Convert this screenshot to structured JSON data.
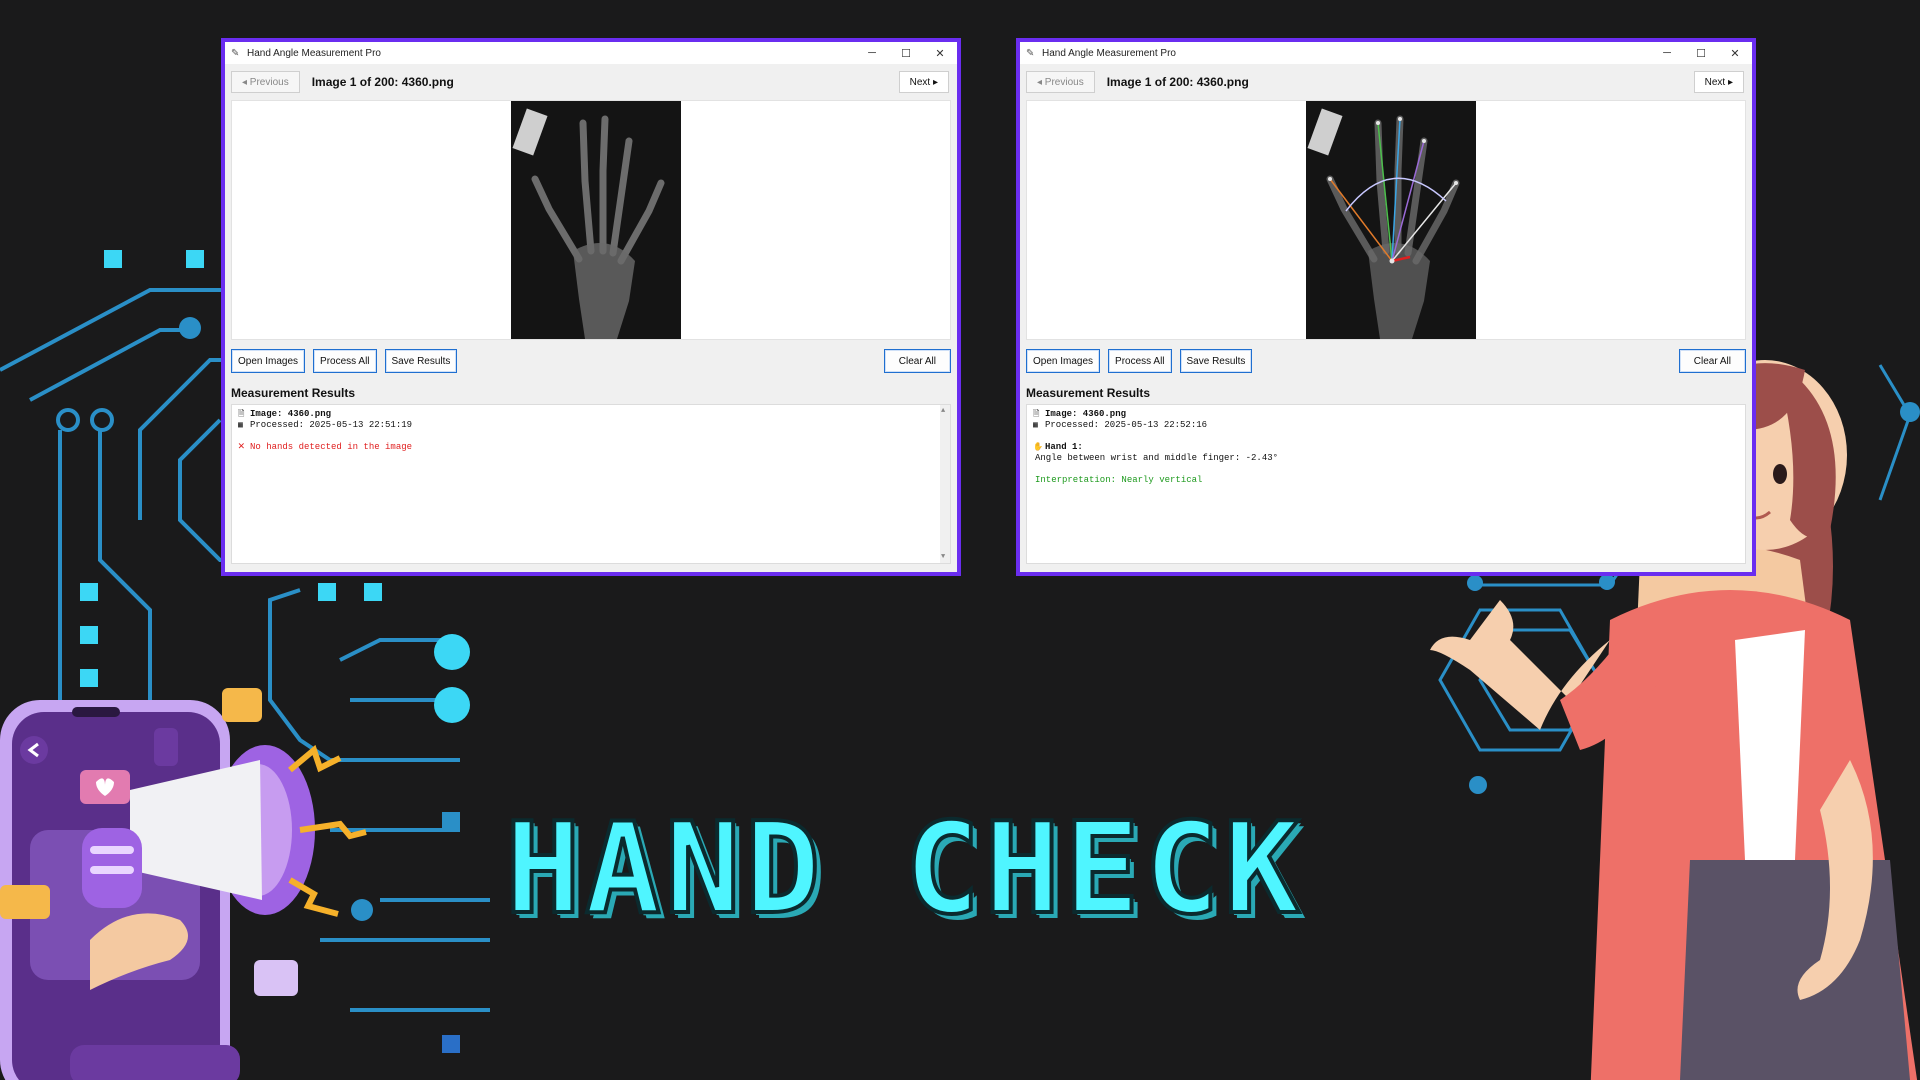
{
  "headline": "HAND CHECK",
  "colors": {
    "accent": "#6a2df0",
    "cyan": "#4ff5ff",
    "error": "#e02020",
    "success": "#1e9a1e"
  },
  "windows": [
    {
      "title": "Hand Angle Measurement Pro",
      "controls": {
        "minimize": "─",
        "maximize": "☐",
        "close": "✕"
      },
      "nav": {
        "prev": "◂ Previous",
        "image_title": "Image 1 of 200: 4360.png",
        "next": "Next ▸"
      },
      "actions": {
        "open": "Open Images",
        "process": "Process All",
        "save": "Save Results",
        "clear": "Clear All"
      },
      "results_title": "Measurement Results",
      "results": {
        "image": "Image: 4360.png",
        "processed": "Processed: 2025-05-13 22:51:19",
        "message": "No hands detected in the image"
      },
      "icons": {
        "file": "file-icon",
        "calendar": "calendar-icon",
        "error": "error-x-icon"
      }
    },
    {
      "title": "Hand Angle Measurement Pro",
      "controls": {
        "minimize": "─",
        "maximize": "☐",
        "close": "✕"
      },
      "nav": {
        "prev": "◂ Previous",
        "image_title": "Image 1 of 200: 4360.png",
        "next": "Next ▸"
      },
      "actions": {
        "open": "Open Images",
        "process": "Process All",
        "save": "Save Results",
        "clear": "Clear All"
      },
      "results_title": "Measurement Results",
      "results": {
        "image": "Image: 4360.png",
        "processed": "Processed: 2025-05-13 22:52:16",
        "hand": "Hand 1:",
        "angle": "Angle between wrist and middle finger: -2.43°",
        "interpretation": "Interpretation: Nearly vertical"
      },
      "icons": {
        "file": "file-icon",
        "calendar": "calendar-icon",
        "hand": "hand-icon"
      }
    }
  ]
}
